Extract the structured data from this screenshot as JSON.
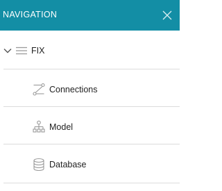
{
  "header": {
    "title": "NAVIGATION",
    "close_icon": "close-icon",
    "background": "#138ea5"
  },
  "tree": {
    "root": {
      "label": "FIX",
      "expand_icon": "chevron-down-icon",
      "type_icon": "hamburger-list-icon",
      "expanded": true
    },
    "children": [
      {
        "label": "Connections",
        "icon": "connections-icon"
      },
      {
        "label": "Model",
        "icon": "model-hierarchy-icon"
      },
      {
        "label": "Database",
        "icon": "database-icon"
      }
    ]
  }
}
